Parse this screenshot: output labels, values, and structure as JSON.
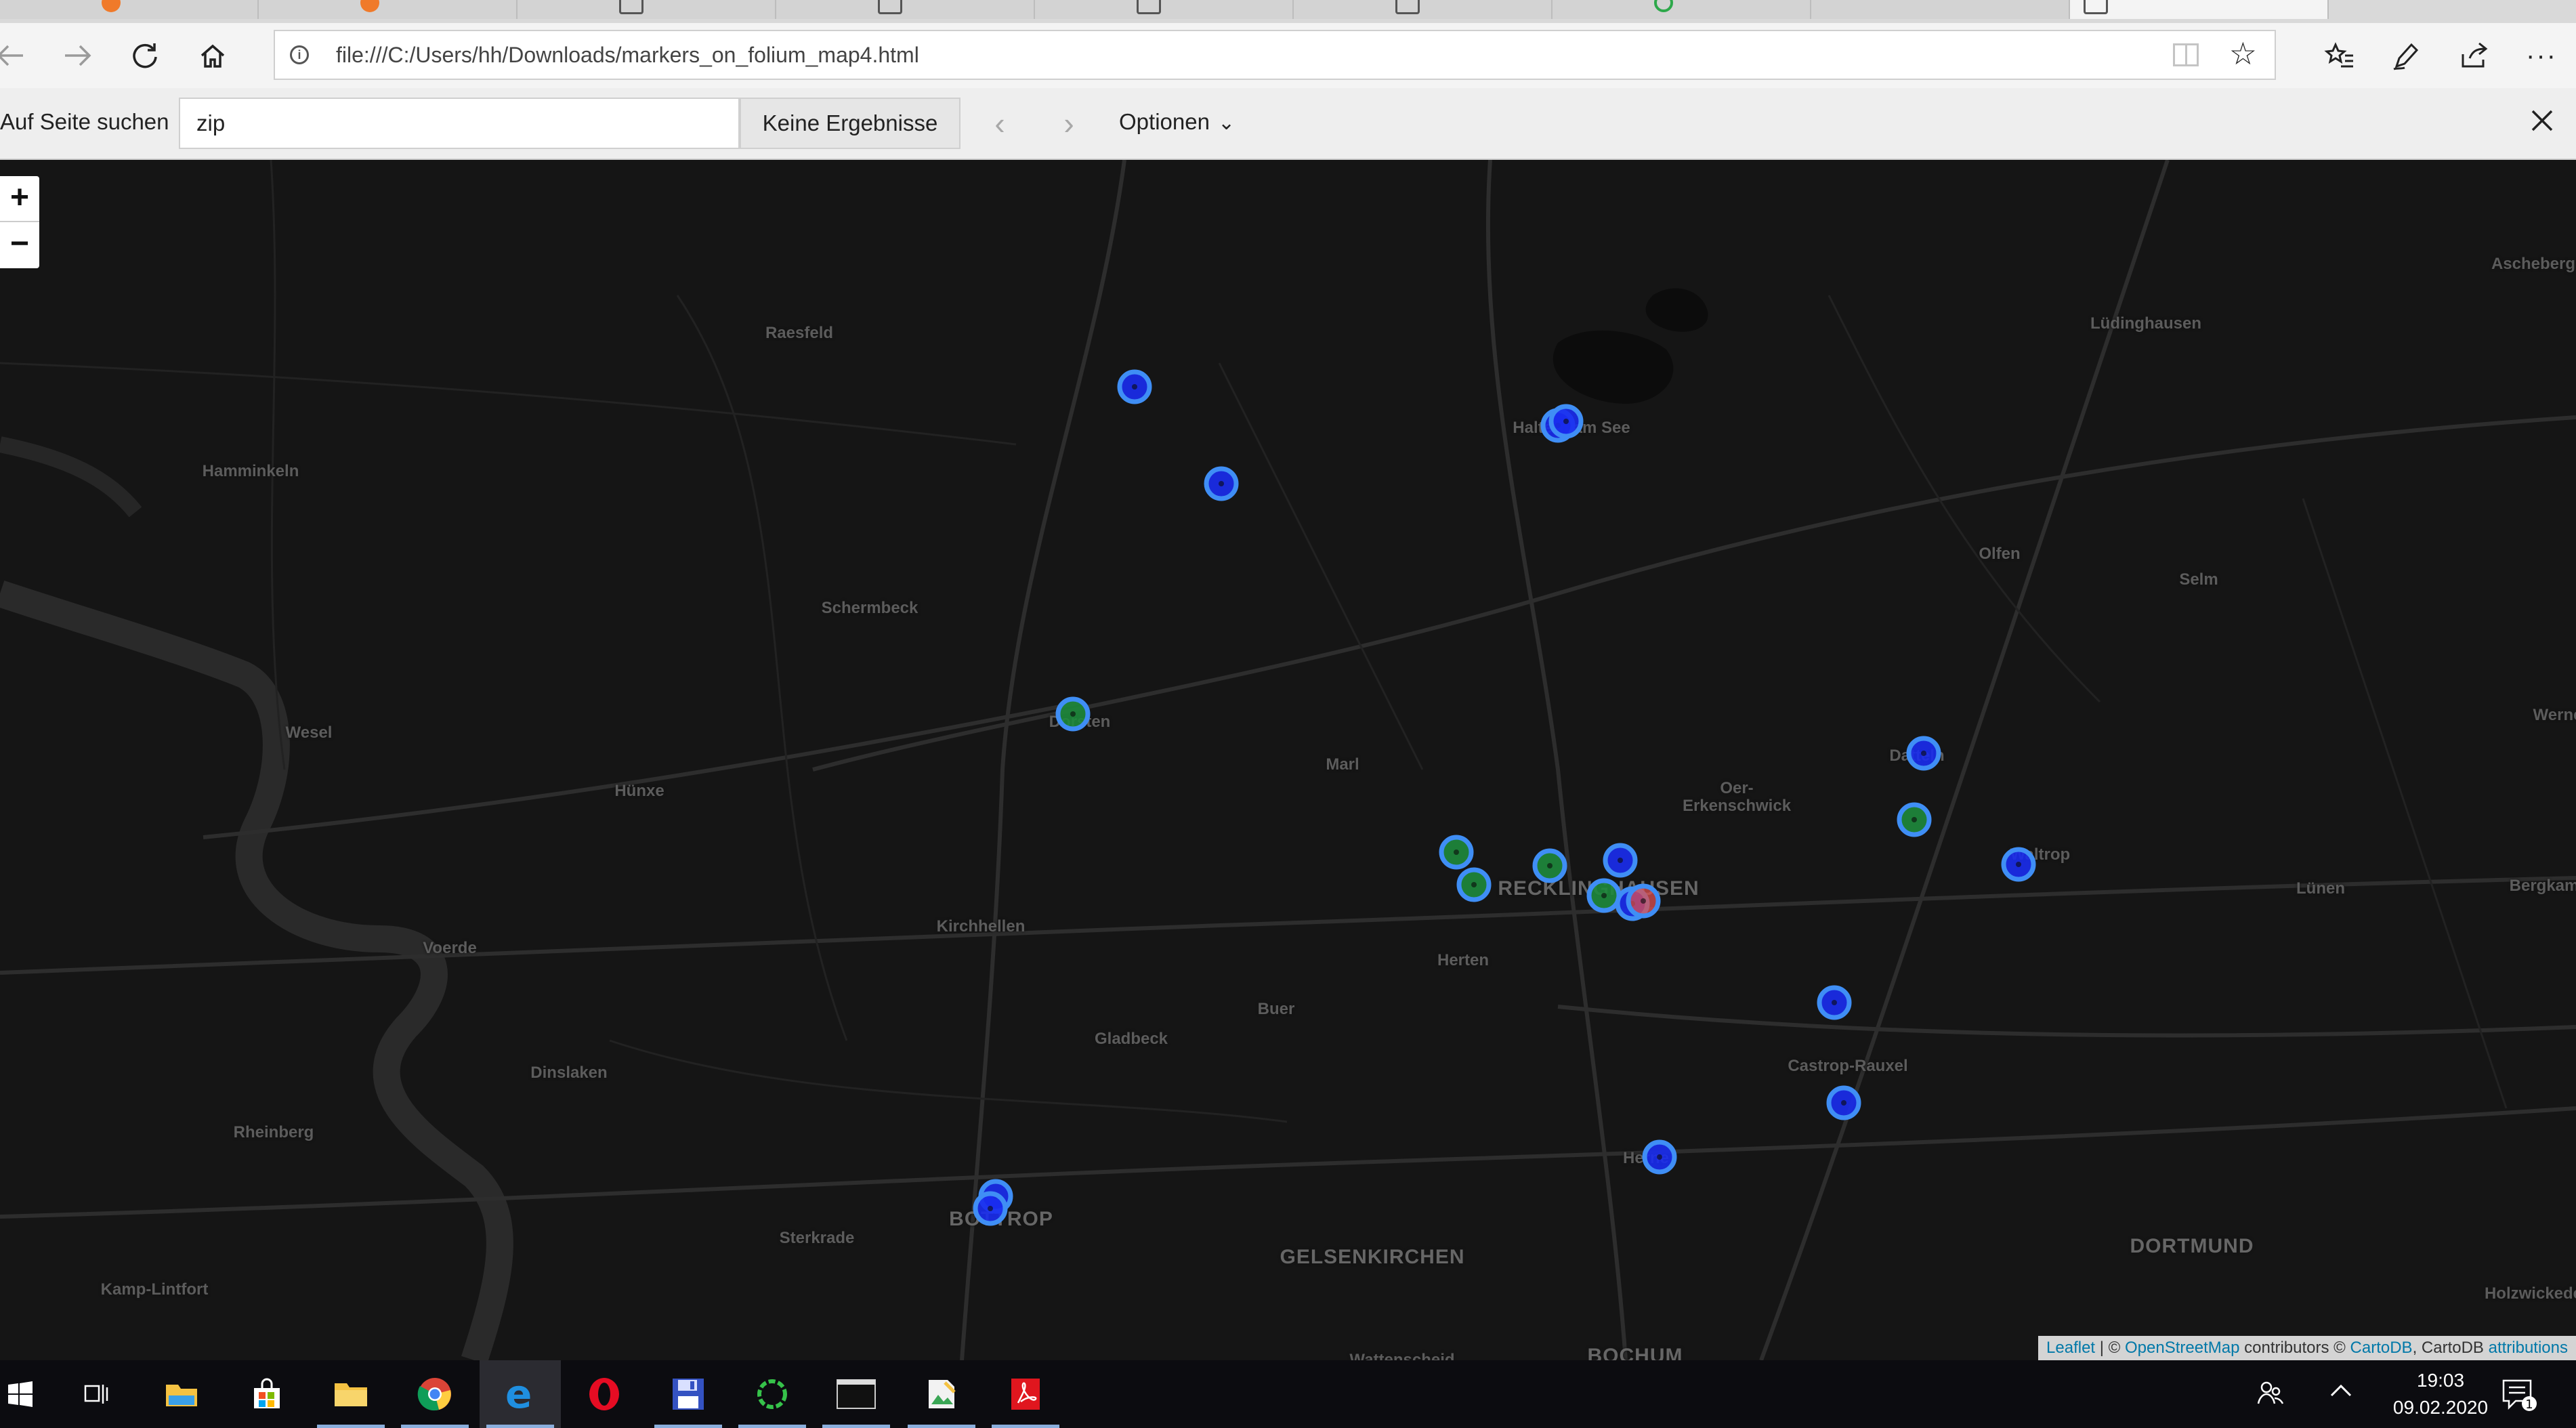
{
  "browser": {
    "url": "file:///C:/Users/hh/Downloads/markers_on_folium_map4.html"
  },
  "find_bar": {
    "label": "Auf Seite suchen",
    "query": "zip",
    "result": "Keine Ergebnisse",
    "options_label": "Optionen"
  },
  "map": {
    "zoom_in_label": "+",
    "zoom_out_label": "−",
    "places": [
      {
        "name": "Raesfeld"
      },
      {
        "name": "Hamminkeln"
      },
      {
        "name": "Schermbeck"
      },
      {
        "name": "Wesel"
      },
      {
        "name": "Hünxe"
      },
      {
        "name": "Voerde"
      },
      {
        "name": "Dinslaken"
      },
      {
        "name": "Rheinberg"
      },
      {
        "name": "Kamp-Lintfort"
      },
      {
        "name": "Sterkrade"
      },
      {
        "name": "Kirchhellen"
      },
      {
        "name": "Gladbeck"
      },
      {
        "name": "Buer"
      },
      {
        "name": "Herten"
      },
      {
        "name": "Marl"
      },
      {
        "name": "Haltern am See"
      },
      {
        "name": "Dorsten"
      },
      {
        "name": "Oer-"
      },
      {
        "name": "Erkenschwick"
      },
      {
        "name": "Olfen"
      },
      {
        "name": "Selm"
      },
      {
        "name": "Lüdinghausen"
      },
      {
        "name": "Ascheberg"
      },
      {
        "name": "Datteln"
      },
      {
        "name": "Waltrop"
      },
      {
        "name": "Lünen"
      },
      {
        "name": "Bergkamen"
      },
      {
        "name": "Werne"
      },
      {
        "name": "Castrop-Rauxel"
      },
      {
        "name": "Herne"
      },
      {
        "name": "Holzwickede"
      },
      {
        "name": "Wattenscheid"
      },
      {
        "name": "RECKLINGHAUSEN"
      },
      {
        "name": "BOTTROP"
      },
      {
        "name": "GELSENKIRCHEN"
      },
      {
        "name": "DORTMUND"
      },
      {
        "name": "BOCHUM"
      }
    ],
    "markers": [
      {
        "color": "blue"
      },
      {
        "color": "blue"
      },
      {
        "color": "blue"
      },
      {
        "color": "blue"
      },
      {
        "color": "green"
      },
      {
        "color": "green"
      },
      {
        "color": "green"
      },
      {
        "color": "green"
      },
      {
        "color": "blue"
      },
      {
        "color": "green"
      },
      {
        "color": "blue"
      },
      {
        "color": "red"
      },
      {
        "color": "blue"
      },
      {
        "color": "green"
      },
      {
        "color": "blue"
      },
      {
        "color": "blue"
      },
      {
        "color": "blue"
      },
      {
        "color": "blue"
      },
      {
        "color": "blue"
      },
      {
        "color": "blue"
      }
    ],
    "attribution": {
      "leaflet": "Leaflet",
      "sep1": " | © ",
      "osm": "OpenStreetMap",
      "contrib": " contributors © ",
      "cartodb": "CartoDB",
      "cartodb2": ", CartoDB ",
      "attributions": "attributions"
    }
  },
  "taskbar": {
    "time": "19:03",
    "date": "09.02.2020",
    "notification_count": "1",
    "apps": [
      "start-icon",
      "task-view-icon",
      "file-explorer-icon",
      "store-icon",
      "folder-icon",
      "chrome-icon",
      "edge-icon",
      "opera-icon",
      "save-app-icon",
      "loading-app-icon",
      "terminal-icon",
      "image-editor-icon",
      "pdf-icon"
    ]
  },
  "colors": {
    "marker_blue_ring": "#3f8ef5",
    "marker_blue_fill": "#1a2cf0",
    "marker_green_fill": "#1e8a3c",
    "marker_red_fill": "#e05050",
    "map_background": "#151515"
  }
}
